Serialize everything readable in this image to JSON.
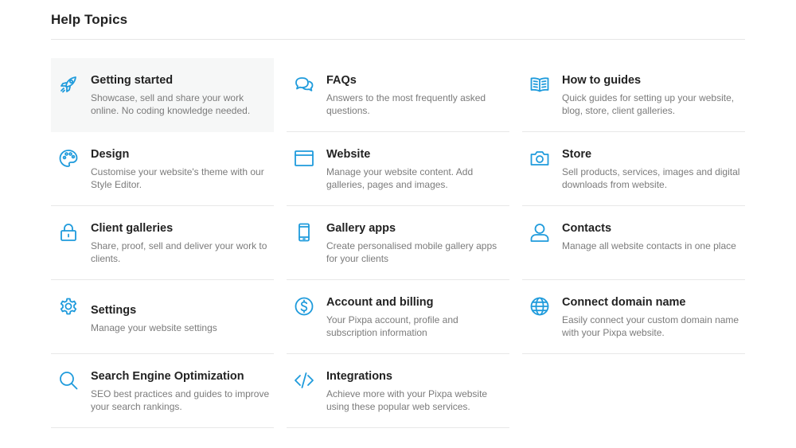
{
  "page": {
    "title": "Help Topics"
  },
  "colors": {
    "accent": "#1f9bdc",
    "title_text": "#222222",
    "desc_text": "#7b7b7b",
    "highlight_bg": "#f6f7f7"
  },
  "topics": [
    {
      "icon": "rocket-icon",
      "title": "Getting started",
      "desc": "Showcase, sell and share your work online. No coding knowledge needed."
    },
    {
      "icon": "chat-bubbles-icon",
      "title": "FAQs",
      "desc": "Answers to the most frequently asked questions."
    },
    {
      "icon": "open-book-icon",
      "title": "How to guides",
      "desc": "Quick guides for setting up your website, blog, store, client galleries."
    },
    {
      "icon": "palette-icon",
      "title": "Design",
      "desc": "Customise your website's theme with our Style Editor."
    },
    {
      "icon": "browser-window-icon",
      "title": "Website",
      "desc": "Manage your website content. Add galleries, pages and images."
    },
    {
      "icon": "camera-icon",
      "title": "Store",
      "desc": "Sell products, services, images and digital downloads from website."
    },
    {
      "icon": "padlock-icon",
      "title": "Client galleries",
      "desc": "Share, proof, sell and deliver your work to clients."
    },
    {
      "icon": "mobile-phone-icon",
      "title": "Gallery apps",
      "desc": "Create personalised mobile gallery apps for your clients"
    },
    {
      "icon": "user-icon",
      "title": "Contacts",
      "desc": "Manage all website contacts in one place"
    },
    {
      "icon": "gear-icon",
      "title": "Settings",
      "desc": "Manage your website settings"
    },
    {
      "icon": "dollar-circle-icon",
      "title": "Account and billing",
      "desc": "Your Pixpa account, profile and subscription information"
    },
    {
      "icon": "globe-icon",
      "title": "Connect domain name",
      "desc": "Easily connect your custom domain name with your Pixpa website."
    },
    {
      "icon": "search-icon",
      "title": "Search Engine Optimization",
      "desc": "SEO best practices and guides to improve your search rankings."
    },
    {
      "icon": "code-icon",
      "title": "Integrations",
      "desc": "Achieve more with your Pixpa website using these popular web services."
    }
  ]
}
